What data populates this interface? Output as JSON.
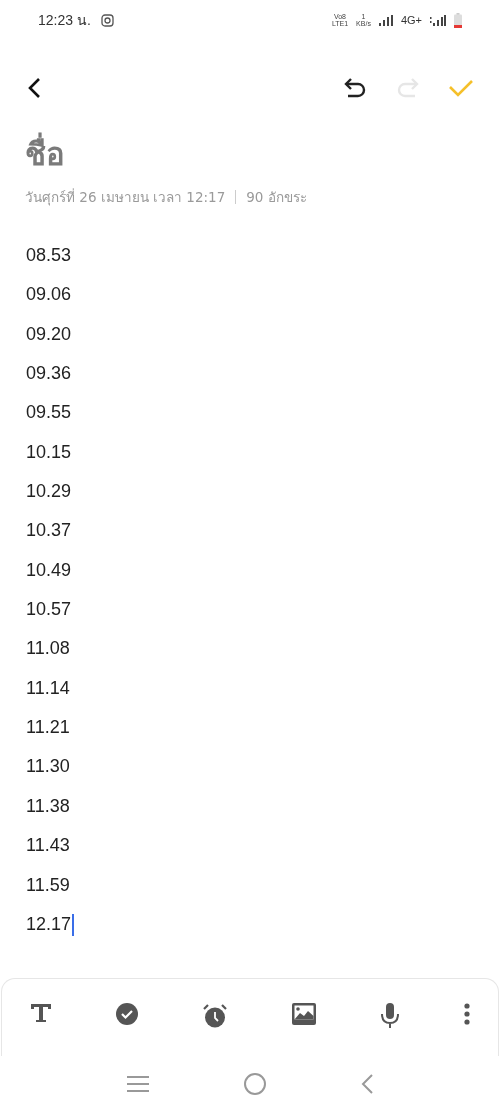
{
  "status_bar": {
    "time": "12:23 น.",
    "volte": "Vo8",
    "lte": "LTE1",
    "speed_value": "1",
    "speed_unit": "KB/s",
    "network": "4G+"
  },
  "toolbar": {
    "undo": {
      "disabled": false
    },
    "redo": {
      "disabled": true
    }
  },
  "note": {
    "title": "ชื่อ",
    "date": "วันศุกร์ที่ 26 เมษายน เวลา 12:17",
    "char_count": "90 อักขระ",
    "lines": [
      "08.53",
      "09.06",
      "09.20",
      "09.36",
      "09.55",
      "10.15",
      "10.29",
      "10.37",
      "10.49",
      "10.57",
      "11.08",
      "11.14",
      "11.21",
      "11.30",
      "11.38",
      "11.43",
      "11.59",
      "12.17"
    ]
  }
}
